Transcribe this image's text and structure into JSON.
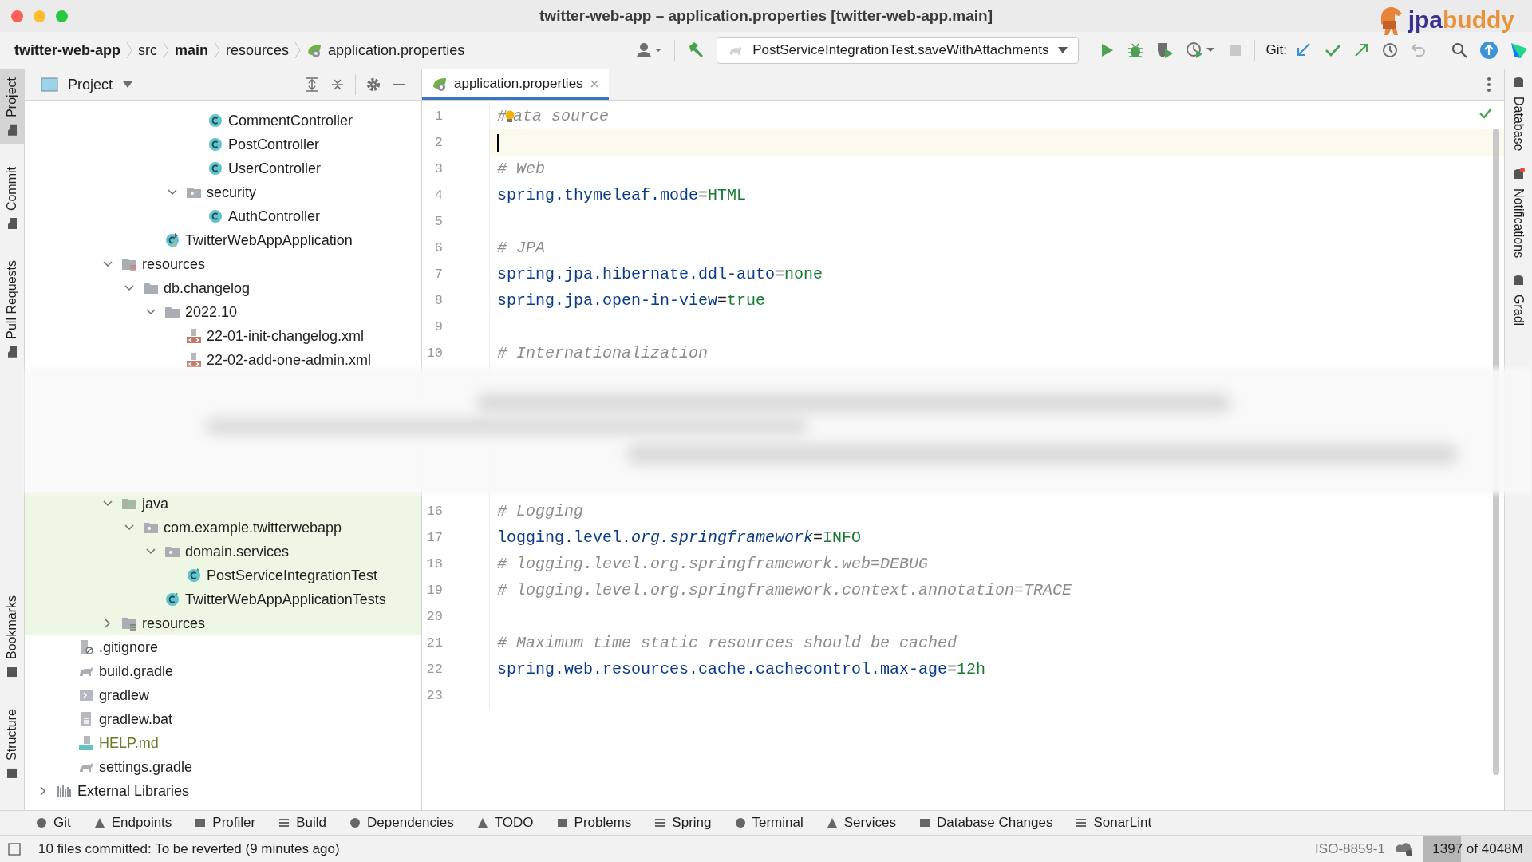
{
  "window": {
    "title": "twitter-web-app – application.properties [twitter-web-app.main]",
    "logo": {
      "part1": "jpa",
      "part2": "buddy"
    }
  },
  "breadcrumbs": [
    {
      "label": "twitter-web-app",
      "bold": true
    },
    {
      "label": "src",
      "bold": false
    },
    {
      "label": "main",
      "bold": true
    },
    {
      "label": "resources",
      "bold": false
    },
    {
      "label": "application.properties",
      "bold": false,
      "kind": "properties"
    }
  ],
  "run_config": {
    "label": "PostServiceIntegrationTest.saveWithAttachments"
  },
  "toolbar": {
    "stop_disabled": true,
    "revert_disabled": true,
    "git_label": "Git:"
  },
  "left_tabs": [
    {
      "label": "Project",
      "selected": true
    },
    {
      "label": "Commit",
      "selected": false
    },
    {
      "label": "Pull Requests",
      "selected": false
    }
  ],
  "left_tabs_bottom": [
    {
      "label": "Bookmarks",
      "selected": false
    },
    {
      "label": "Structure",
      "selected": false
    }
  ],
  "right_tabs": [
    {
      "label": "Database"
    },
    {
      "label": "Notifications",
      "badge": true
    },
    {
      "label": "Gradl"
    }
  ],
  "project_panel": {
    "title": "Project",
    "tree": [
      {
        "children": [
          {
            "children": [
              {
                "children": [
                  {
                    "children": [
                      {
                        "children": [
                          {
                            "children": [
                              {
                                "children": [
                                  {
                                    "label": "CommentController",
                                    "kind": "class"
                                  },
                                  {
                                    "label": "PostController",
                                    "kind": "class"
                                  },
                                  {
                                    "label": "UserController",
                                    "kind": "class"
                                  }
                                ]
                              },
                              {
                                "label": "security",
                                "kind": "package",
                                "expanded": true,
                                "children": [
                                  {
                                    "label": "AuthController",
                                    "kind": "class"
                                  }
                                ]
                              }
                            ]
                          },
                          {
                            "label": "TwitterWebAppApplication",
                            "kind": "spring-app"
                          }
                        ]
                      }
                    ]
                  },
                  {
                    "label": "resources",
                    "kind": "resources",
                    "expanded": true,
                    "children": [
                      {
                        "label": "db.changelog",
                        "kind": "folder",
                        "expanded": true,
                        "children": [
                          {
                            "label": "2022.10",
                            "kind": "folder",
                            "expanded": true,
                            "children": [
                              {
                                "label": "22-01-init-changelog.xml",
                                "kind": "xml"
                              },
                              {
                                "label": "22-02-add-one-admin.xml",
                                "kind": "xml"
                              }
                            ]
                          }
                        ]
                      }
                    ]
                  }
                ]
              },
              {
                "kind": "blurred"
              },
              {
                "kind": "blurred"
              },
              {
                "kind": "blurred"
              },
              {
                "kind": "blurred"
              },
              {
                "kind": "blurred"
              },
              {
                "highlighted": true,
                "children": [
                  {
                    "label": "java",
                    "kind": "test-folder",
                    "expanded": true,
                    "children": [
                      {
                        "label": "com.example.twitterwebapp",
                        "kind": "package",
                        "expanded": true,
                        "children": [
                          {
                            "label": "domain.services",
                            "kind": "package",
                            "expanded": true,
                            "children": [
                              {
                                "label": "PostServiceIntegrationTest",
                                "kind": "test-class"
                              }
                            ]
                          },
                          {
                            "label": "TwitterWebAppApplicationTests",
                            "kind": "test-class"
                          }
                        ]
                      }
                    ]
                  },
                  {
                    "label": "resources",
                    "kind": "test-resources",
                    "expanded": false
                  }
                ]
              }
            ]
          },
          {
            "label": ".gitignore",
            "kind": "ignore"
          },
          {
            "label": "build.gradle",
            "kind": "gradle"
          },
          {
            "label": "gradlew",
            "kind": "script"
          },
          {
            "label": "gradlew.bat",
            "kind": "text"
          },
          {
            "label": "HELP.md",
            "kind": "markdown",
            "added": true
          },
          {
            "label": "settings.gradle",
            "kind": "gradle"
          }
        ]
      },
      {
        "label": "External Libraries",
        "kind": "libraries",
        "expanded": false
      }
    ]
  },
  "editor": {
    "tab": {
      "label": "application.properties",
      "selected": true
    },
    "lines": [
      {
        "number": "1",
        "kind": "comment_bulb",
        "parts": [
          "#",
          "ata source"
        ]
      },
      {
        "number": "2",
        "kind": "blank",
        "current": true
      },
      {
        "number": "3",
        "kind": "comment",
        "text": "# Web"
      },
      {
        "number": "4",
        "kind": "property",
        "key": "spring.thymeleaf.mode",
        "sep": "=",
        "value": "HTML"
      },
      {
        "number": "5",
        "kind": "blank"
      },
      {
        "number": "6",
        "kind": "comment",
        "text": "# JPA"
      },
      {
        "number": "7",
        "kind": "property",
        "key": "spring.jpa.hibernate.ddl-auto",
        "sep": "=",
        "value": "none"
      },
      {
        "number": "8",
        "kind": "property",
        "key": "spring.jpa.open-in-view",
        "sep": "=",
        "value": "true"
      },
      {
        "number": "9",
        "kind": "blank"
      },
      {
        "number": "10",
        "kind": "comment",
        "text": "# Internationalization"
      },
      {
        "kind": "blurred"
      },
      {
        "kind": "blurred"
      },
      {
        "kind": "blurred"
      },
      {
        "kind": "blurred"
      },
      {
        "kind": "blurred"
      },
      {
        "number": "16",
        "kind": "comment",
        "text": "# Logging"
      },
      {
        "number": "17",
        "kind": "property",
        "key": "logging.level.*org.springframework*",
        "sep": "=",
        "value": "INFO"
      },
      {
        "number": "18",
        "kind": "comment",
        "text": "# logging.level.org.springframework.web=DEBUG"
      },
      {
        "number": "19",
        "kind": "comment",
        "text": "# logging.level.org.springframework.context.annotation=TRACE"
      },
      {
        "number": "20",
        "kind": "blank"
      },
      {
        "number": "21",
        "kind": "comment",
        "text": "# Maximum time static resources should be cached"
      },
      {
        "number": "22",
        "kind": "property",
        "key": "spring.web.resources.cache.cachecontrol.max-age",
        "sep": "=",
        "value": "12h"
      },
      {
        "number": "23",
        "kind": "blank"
      }
    ]
  },
  "tool_tabs": [
    "Git",
    "Endpoints",
    "Profiler",
    "Build",
    "Dependencies",
    "TODO",
    "Problems",
    "Spring",
    "Terminal",
    "Services",
    "Database Changes",
    "SonarLint"
  ],
  "status_bar": {
    "message": "10 files committed: To be reverted (9 minutes ago)",
    "encoding": "ISO-8859-1",
    "memory": {
      "text": "1397 of 4048M",
      "level": 0.345
    }
  }
}
